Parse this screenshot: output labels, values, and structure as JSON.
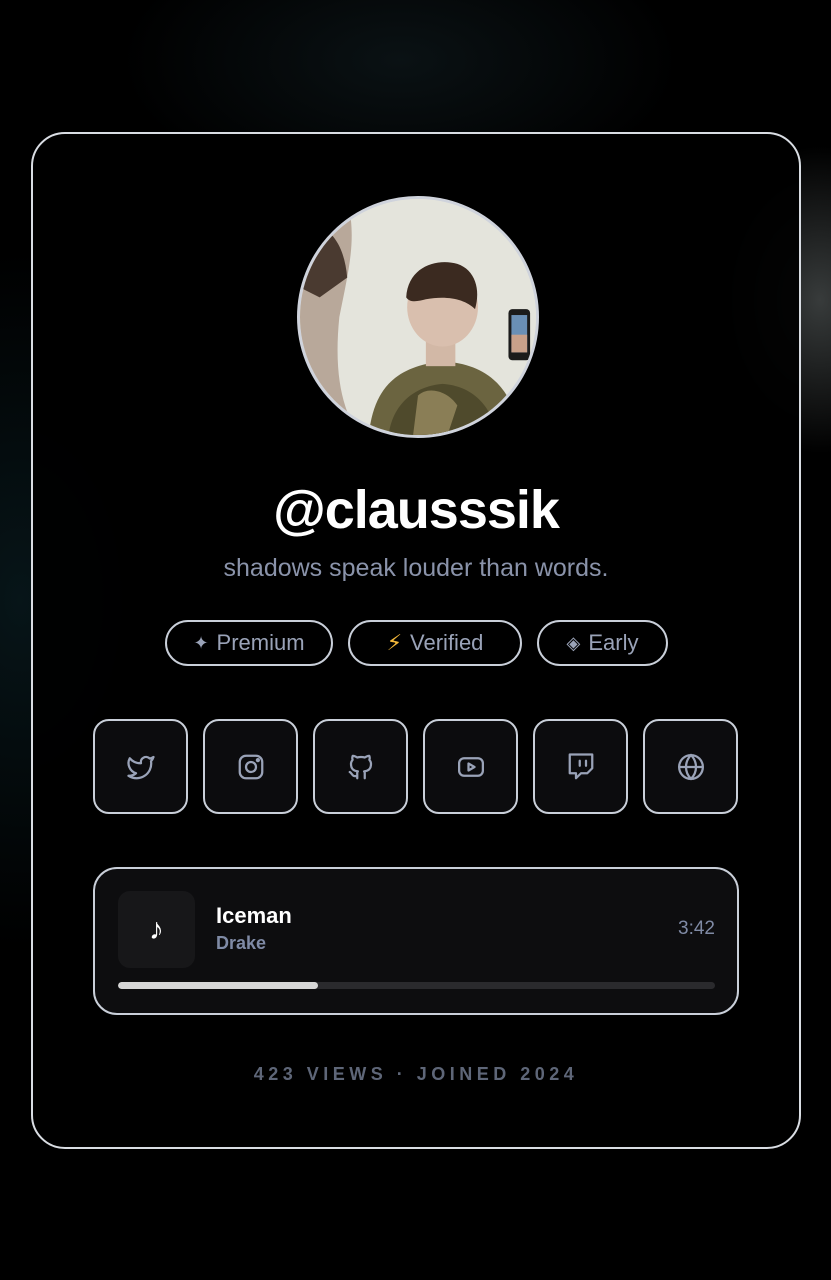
{
  "profile": {
    "username": "@clausssik",
    "bio": "shadows speak louder than words."
  },
  "badges": [
    {
      "icon": "sparkle-icon",
      "glyph": "✦",
      "label": "Premium"
    },
    {
      "icon": "lightning-icon",
      "glyph": "⚡",
      "label": "Verified"
    },
    {
      "icon": "diamond-icon",
      "glyph": "◈",
      "label": "Early"
    }
  ],
  "socials": [
    {
      "icon": "twitter-icon"
    },
    {
      "icon": "instagram-icon"
    },
    {
      "icon": "github-icon"
    },
    {
      "icon": "youtube-icon"
    },
    {
      "icon": "twitch-icon"
    },
    {
      "icon": "globe-icon"
    }
  ],
  "player": {
    "cover_glyph": "♪",
    "title": "Iceman",
    "artist": "Drake",
    "duration": "3:42",
    "progress": 0.335
  },
  "stats": {
    "text": "423 VIEWS · JOINED 2024"
  },
  "colors": {
    "accent": "#8a93aa",
    "bolt": "#f5b93a",
    "border": "#c9cfd9"
  }
}
